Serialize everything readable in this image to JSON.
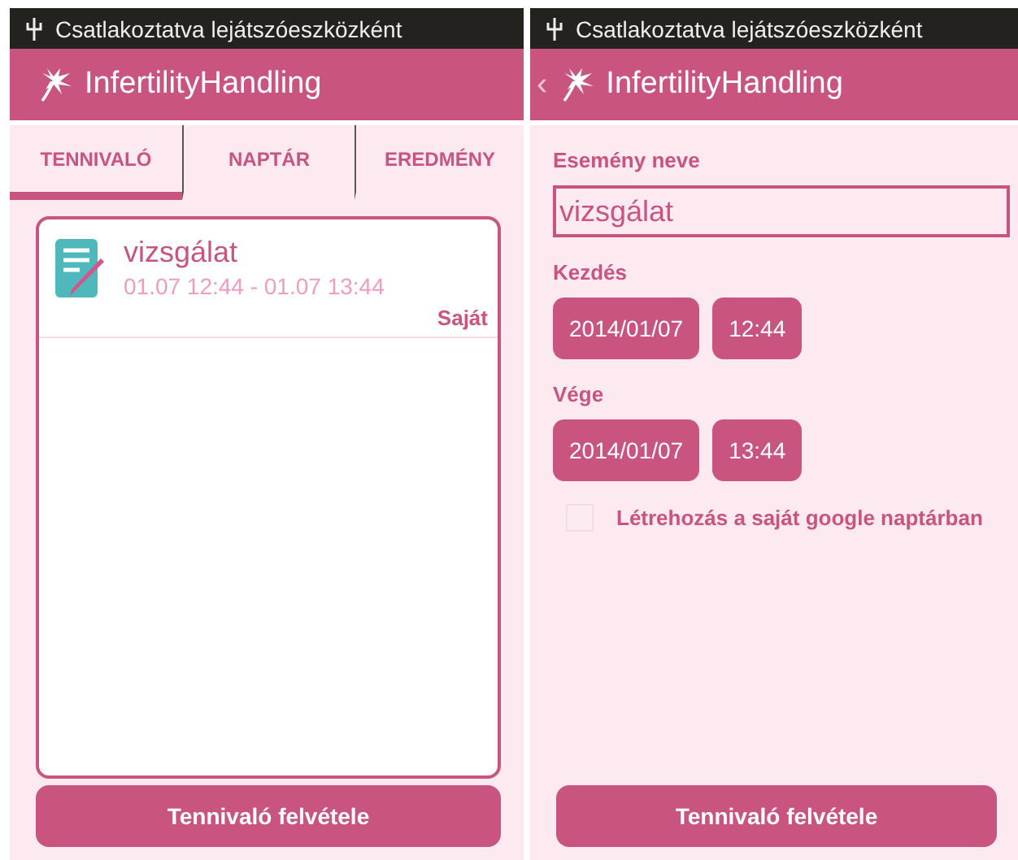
{
  "left_screen": {
    "status_bar": {
      "text": "Csatlakoztatva lejátszóeszközként"
    },
    "app_bar": {
      "title": "InfertilityHandling"
    },
    "tabs": [
      {
        "label": "TENNIVALÓ",
        "selected": true
      },
      {
        "label": "NAPTÁR",
        "selected": false
      },
      {
        "label": "EREDMÉNY",
        "selected": false
      }
    ],
    "todo_list": [
      {
        "title": "vizsgálat",
        "time": "01.07 12:44 - 01.07 13:44",
        "tag": "Saját"
      }
    ],
    "button": "Tennivaló felvétele"
  },
  "right_screen": {
    "status_bar": {
      "text": "Csatlakoztatva lejátszóeszközként"
    },
    "app_bar": {
      "title": "InfertilityHandling",
      "back": "‹"
    },
    "name_label": "Esemény neve",
    "name_value": "vizsgálat",
    "start": {
      "label": "Kezdés",
      "date": "2014/01/07",
      "time": "12:44"
    },
    "end": {
      "label": "Vége",
      "date": "2014/01/07",
      "time": "13:44"
    },
    "google_checkbox": {
      "label": "Létrehozás a saját google naptárban",
      "checked": false
    },
    "button": "Tennivaló felvétele"
  }
}
